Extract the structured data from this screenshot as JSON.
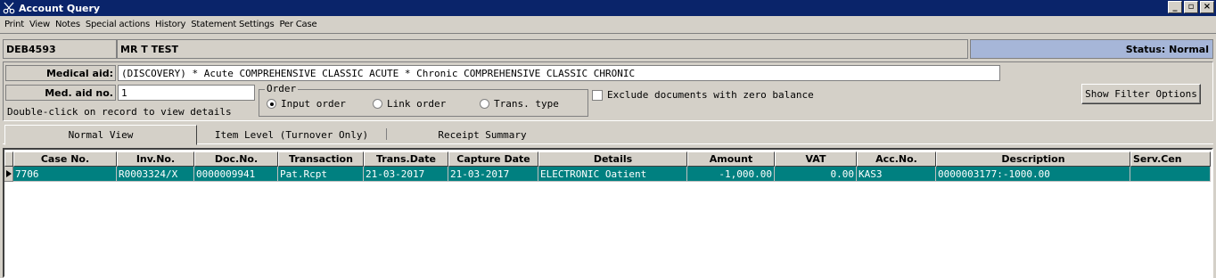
{
  "window": {
    "title": "Account Query",
    "controls": [
      "_",
      "▫",
      "×"
    ]
  },
  "menu": [
    "Print",
    "View",
    "Notes",
    "Special actions",
    "History",
    "Statement Settings",
    "Per Case"
  ],
  "account": {
    "number": "DEB4593",
    "name": "MR T TEST",
    "status": "Status: Normal"
  },
  "medical_aid": {
    "label": "Medical aid:",
    "value": "(DISCOVERY) * Acute COMPREHENSIVE CLASSIC ACUTE * Chronic COMPREHENSIVE CLASSIC CHRONIC"
  },
  "med_aid_no": {
    "label": "Med. aid no.",
    "value": "1"
  },
  "hint": "Double-click on record to view details",
  "order": {
    "title": "Order",
    "options": [
      "Input order",
      "Link order",
      "Trans. type"
    ],
    "selected": "Input order"
  },
  "exclude_zero": {
    "label": "Exclude documents with zero balance",
    "checked": false
  },
  "show_filter_button": "Show Filter Options",
  "tabs": [
    "Normal View",
    "Item Level (Turnover Only)",
    "Receipt Summary"
  ],
  "active_tab": "Normal View",
  "table": {
    "columns": [
      "Case No.",
      "Inv.No.",
      "Doc.No.",
      "Transaction",
      "Trans.Date",
      "Capture Date",
      "Details",
      "Amount",
      "VAT",
      "Acc.No.",
      "Description",
      "Serv.Cen"
    ],
    "rows": [
      [
        "7706",
        "R0003324/X",
        "0000009941",
        "Pat.Rcpt",
        "21-03-2017",
        "21-03-2017",
        "ELECTRONIC Oatient",
        "-1,000.00",
        "0.00",
        "KAS3",
        "0000003177:-1000.00",
        ""
      ]
    ]
  }
}
